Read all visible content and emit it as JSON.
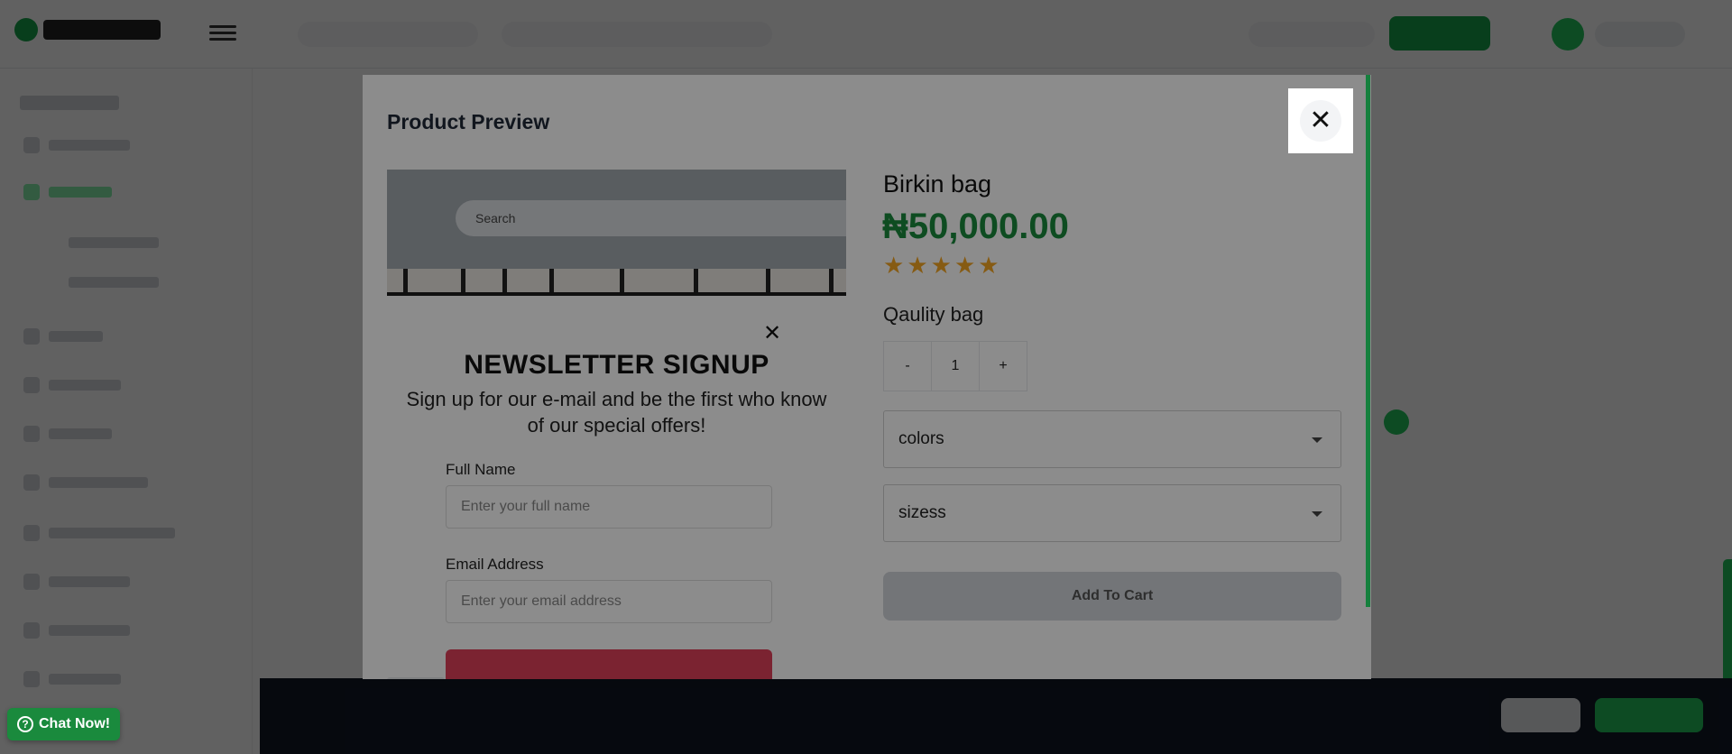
{
  "modal": {
    "title": "Product Preview",
    "close_icon": "close-icon"
  },
  "preview_image": {
    "search_placeholder": "Search"
  },
  "newsletter": {
    "close_icon": "close-icon",
    "title": "NEWSLETTER SIGNUP",
    "subtitle": "Sign up for our e-mail and be the first who know of our special offers!",
    "full_name_label": "Full Name",
    "full_name_placeholder": "Enter your full name",
    "email_label": "Email Address",
    "email_placeholder": "Enter your email address"
  },
  "product": {
    "name": "Birkin bag",
    "price": "₦50,000.00",
    "rating": 5,
    "rating_max": 5,
    "description": "Qaulity bag",
    "quantity": {
      "decrement": "-",
      "value": "1",
      "increment": "+"
    },
    "colors_select": "colors",
    "sizes_select": "sizess",
    "add_to_cart": "Add To Cart"
  },
  "chat": {
    "label": "Chat Now!",
    "icon": "question-circle-icon"
  },
  "colors": {
    "brand_green": "#1a8a3d",
    "star": "#f5a623",
    "newsletter_button": "#e0415a",
    "overlay": "rgba(0,0,0,0.62)"
  }
}
